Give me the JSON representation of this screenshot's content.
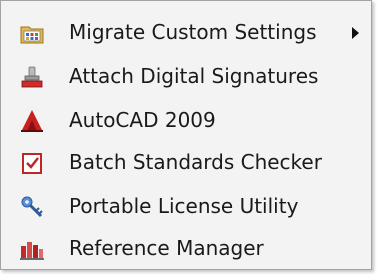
{
  "menu": {
    "items": [
      {
        "label": "Migrate Custom Settings",
        "icon": "folder-grid-icon",
        "has_submenu": true
      },
      {
        "label": "Attach Digital Signatures",
        "icon": "stamp-icon",
        "has_submenu": false
      },
      {
        "label": "AutoCAD 2009",
        "icon": "autocad-logo-icon",
        "has_submenu": false
      },
      {
        "label": "Batch Standards Checker",
        "icon": "checklist-icon",
        "has_submenu": false
      },
      {
        "label": "Portable License Utility",
        "icon": "key-icon",
        "has_submenu": false
      },
      {
        "label": "Reference Manager",
        "icon": "reference-manager-icon",
        "has_submenu": false
      }
    ]
  }
}
